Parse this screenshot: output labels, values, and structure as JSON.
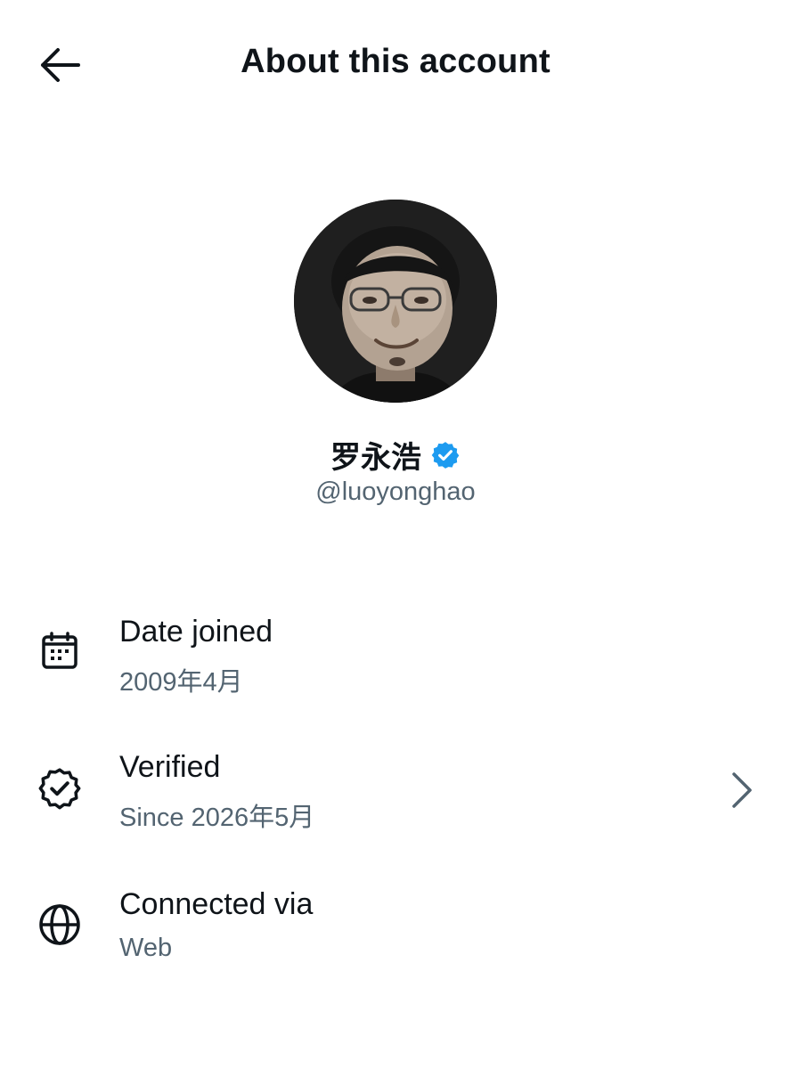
{
  "header": {
    "title": "About this account",
    "back_icon": "arrow-left-icon"
  },
  "profile": {
    "display_name": "罗永浩",
    "verified_badge_icon": "verified-badge-icon",
    "handle": "@luoyonghao",
    "accent_color": "#1d9bf0"
  },
  "info": [
    {
      "icon": "calendar-icon",
      "title": "Date joined",
      "value": "2009年4月"
    },
    {
      "icon": "verified-outline-icon",
      "title": "Verified",
      "value": "Since 2026年5月",
      "chevron_icon": "chevron-right-icon"
    },
    {
      "icon": "globe-icon",
      "title": "Connected via",
      "value": "Web"
    }
  ]
}
